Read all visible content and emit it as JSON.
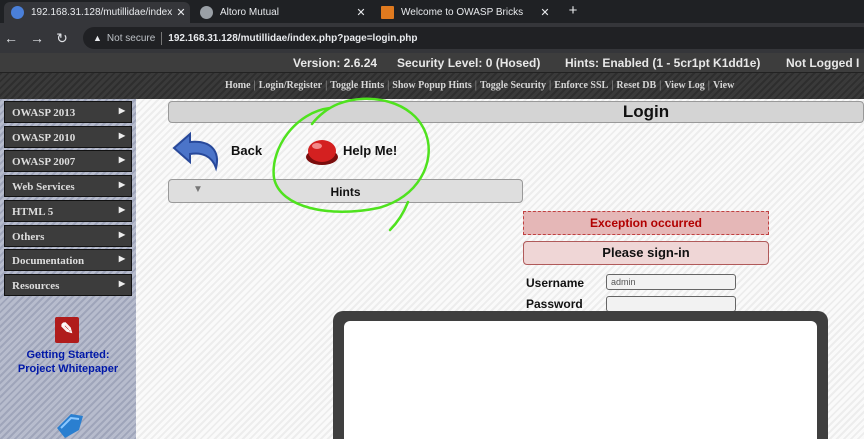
{
  "browser": {
    "tabs": [
      {
        "title": "192.168.31.128/mutillidae/index.",
        "active": true
      },
      {
        "title": "Altoro Mutual",
        "active": false
      },
      {
        "title": "Welcome to OWASP Bricks",
        "active": false
      }
    ],
    "security_label": "Not secure",
    "url": "192.168.31.128/mutillidae/index.php?page=login.php"
  },
  "header": {
    "version": "Version: 2.6.24",
    "security_level": "Security Level: 0 (Hosed)",
    "hints": "Hints: Enabled (1 - 5cr1pt K1dd1e)",
    "login_status": "Not Logged I"
  },
  "menu": {
    "items": [
      "Home",
      "Login/Register",
      "Toggle Hints",
      "Show Popup Hints",
      "Toggle Security",
      "Enforce SSL",
      "Reset DB",
      "View Log",
      "View"
    ]
  },
  "sidebar": {
    "items": [
      "OWASP 2013",
      "OWASP 2010",
      "OWASP 2007",
      "Web Services",
      "HTML 5",
      "Others",
      "Documentation",
      "Resources"
    ],
    "getting_started": "Getting Started:",
    "whitepaper": "Project Whitepaper"
  },
  "content": {
    "title": "Login",
    "back_label": "Back",
    "help_label": "Help Me!",
    "hints_label": "Hints",
    "exception": "Exception occurred",
    "signin": "Please sign-in",
    "username_label": "Username",
    "username_value": "admin",
    "password_label": "Password"
  },
  "colors": {
    "annotation": "#4fe21e",
    "exception_text": "#b10000",
    "link_blue": "#0018a8"
  }
}
